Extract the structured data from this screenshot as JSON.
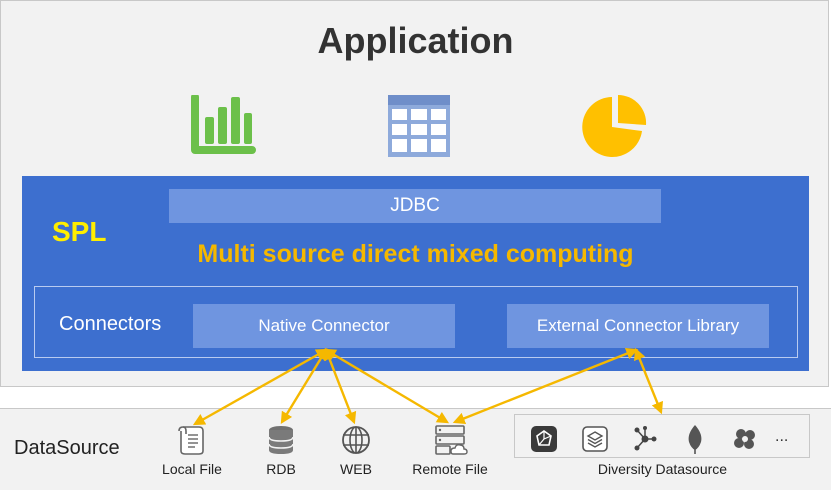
{
  "application": {
    "title": "Application"
  },
  "icons": {
    "bar_chart": "bar-chart-icon",
    "table": "table-icon",
    "pie_chart": "pie-chart-icon"
  },
  "spl": {
    "label": "SPL",
    "jdbc": "JDBC",
    "headline": "Multi source direct mixed computing"
  },
  "connectors": {
    "label": "Connectors",
    "native": "Native Connector",
    "external": "External Connector Library"
  },
  "datasource": {
    "label": "DataSource",
    "items": [
      "Local File",
      "RDB",
      "WEB",
      "Remote File"
    ],
    "diversity_label": "Diversity Datasource",
    "diversity_more": "..."
  },
  "colors": {
    "spl_blue": "#3d6fcf",
    "accent_yellow": "#f5b800",
    "spl_label_yellow": "#ffee00",
    "bar_green": "#6cc04a",
    "table_blue": "#8eaadb",
    "pie_yellow": "#ffc000"
  }
}
